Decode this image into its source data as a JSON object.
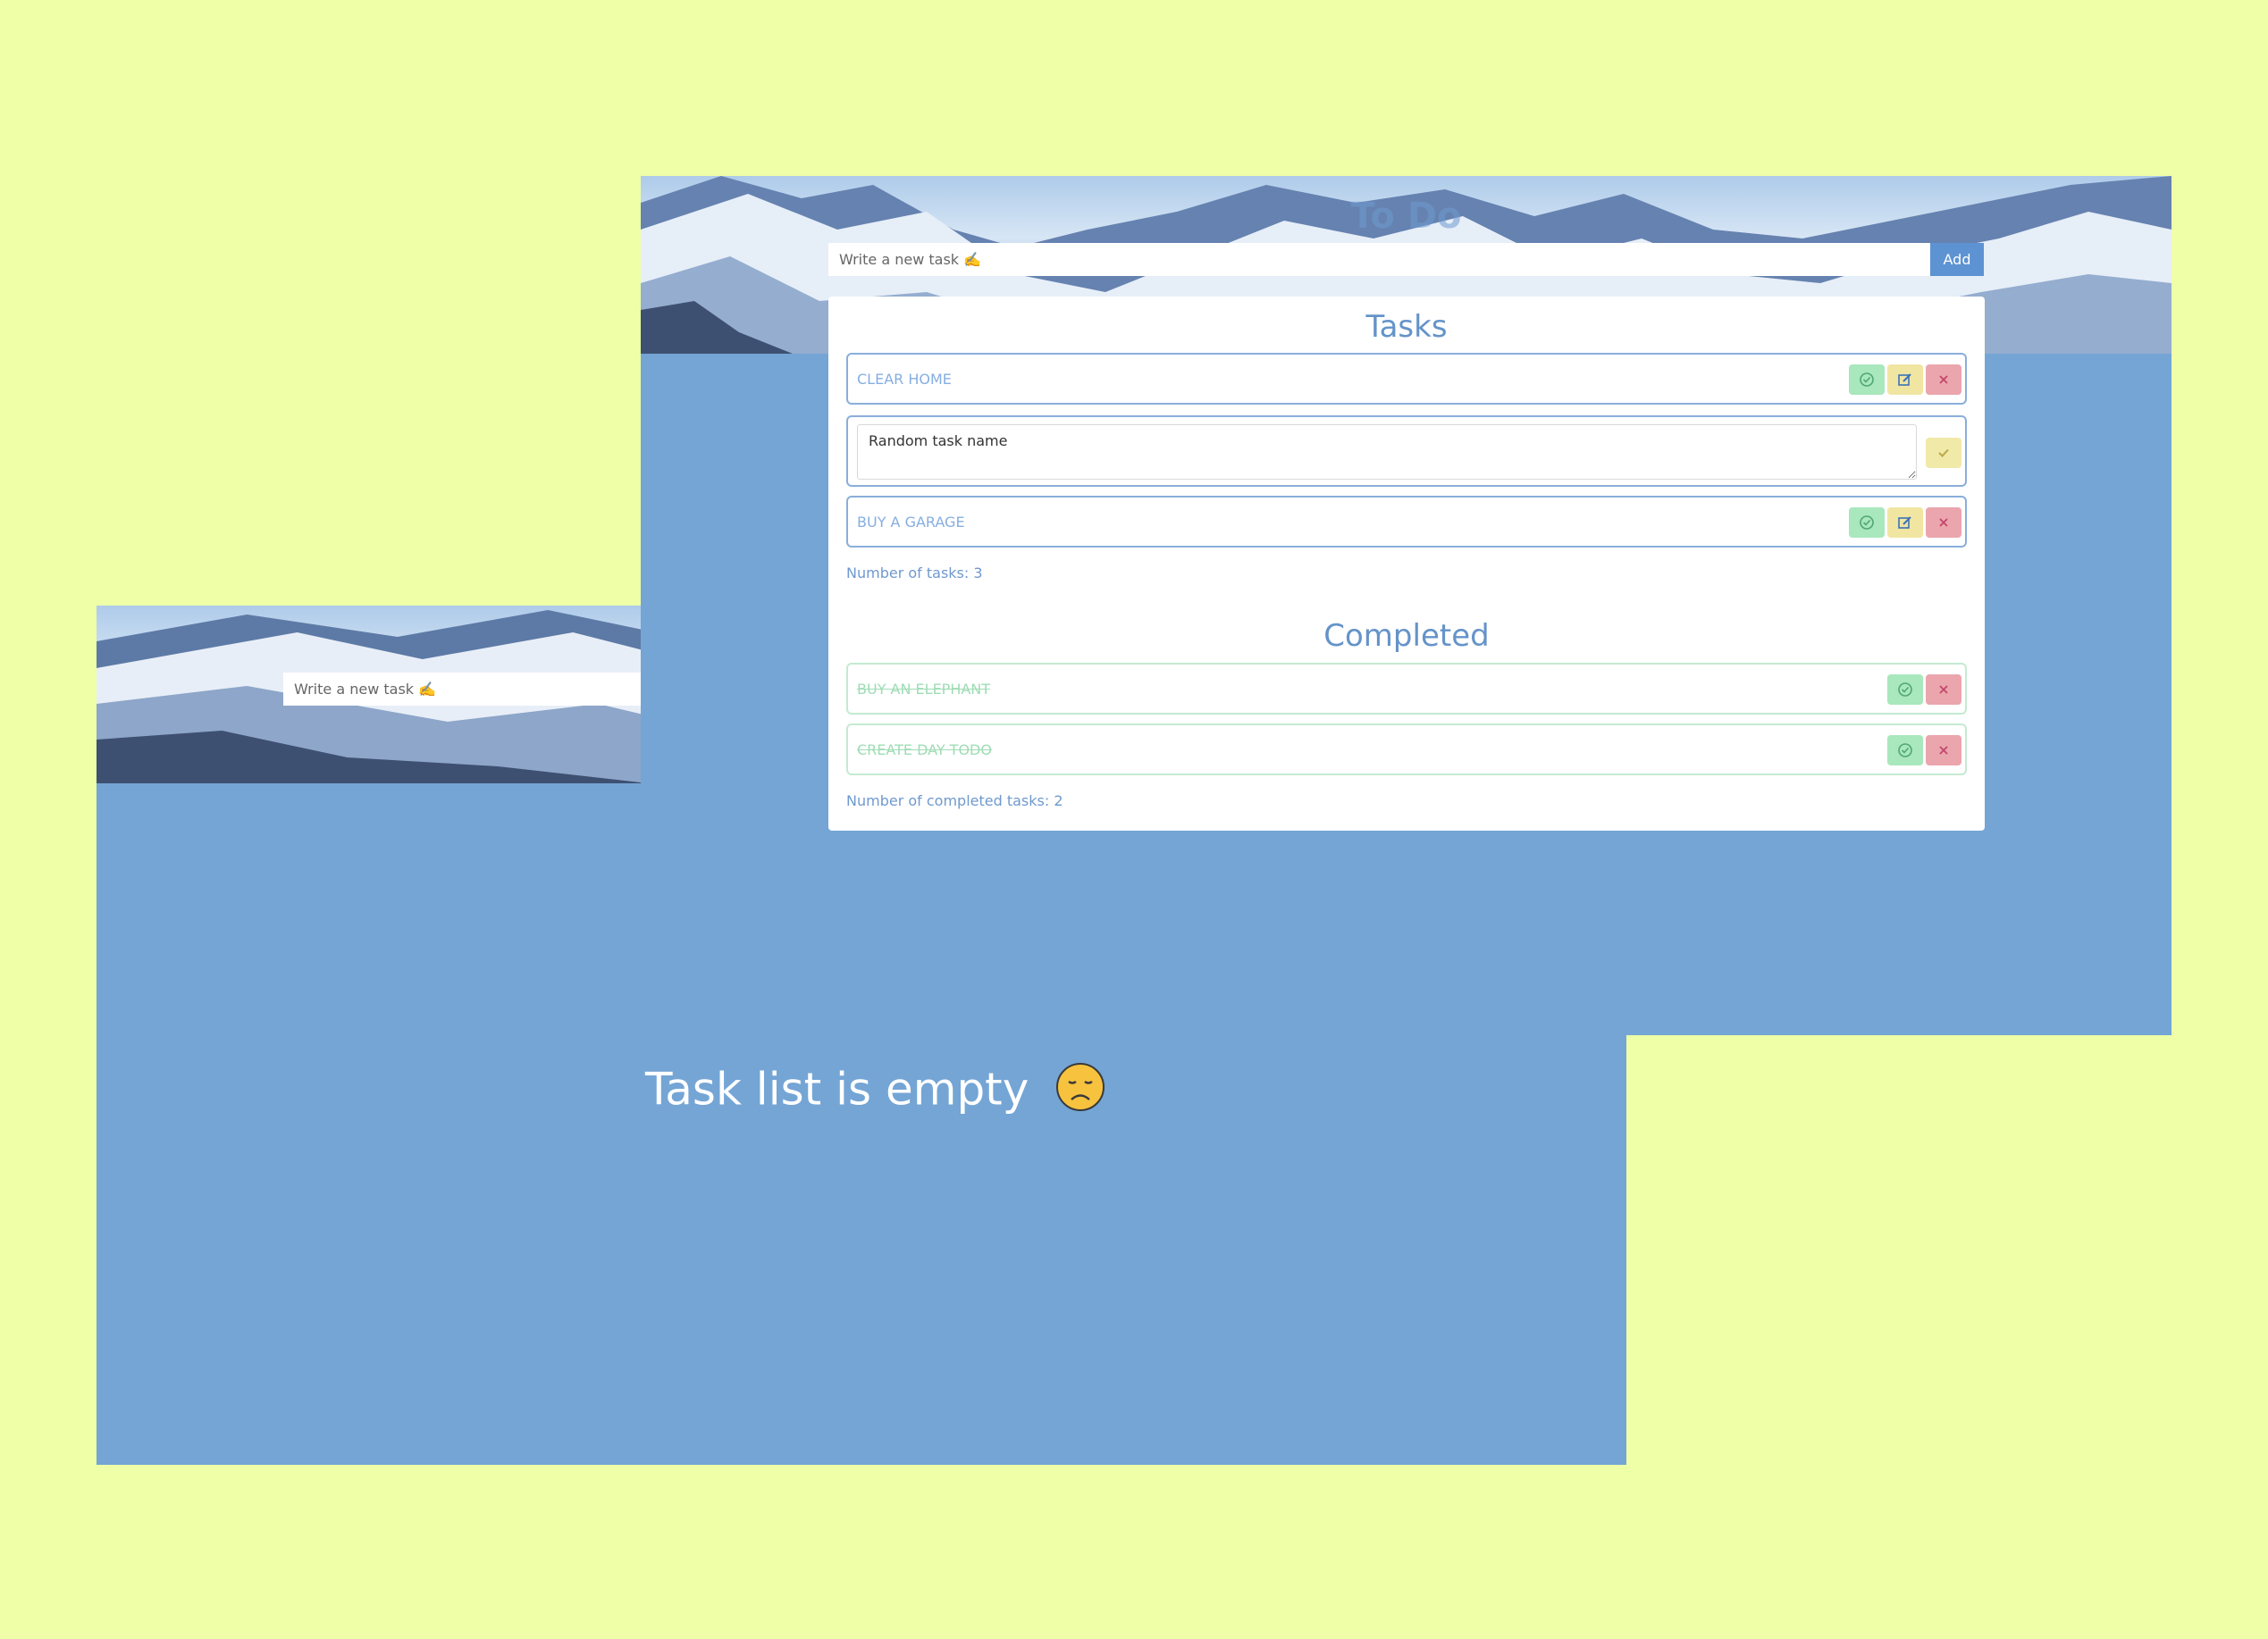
{
  "back_screen": {
    "input_placeholder": "Write a new task ✍️",
    "empty_message": "Task list is empty"
  },
  "front_screen": {
    "title": "To Do",
    "input_placeholder": "Write a new task ✍️",
    "add_label": "Add",
    "tasks_heading": "Tasks",
    "tasks": [
      {
        "label": "Clear home"
      },
      {
        "label": "Random task name",
        "editing": true
      },
      {
        "label": "Buy a garage"
      }
    ],
    "tasks_count": "Number of tasks: 3",
    "completed_heading": "Completed",
    "completed": [
      {
        "label": "Buy an elephant"
      },
      {
        "label": "Create day todo"
      }
    ],
    "completed_count": "Number of completed tasks: 2"
  },
  "colors": {
    "page_background": "#eeffa8",
    "app_background": "#74a5d5",
    "accent": "#5d93d2",
    "complete_button": "#a9e7bd",
    "edit_button": "#f1e5a2",
    "delete_button": "#eba5ad"
  },
  "icons": {
    "complete": "check-circle-icon",
    "edit": "pencil-square-icon",
    "delete": "close-icon",
    "save": "check-icon",
    "empty": "sad-face-emoji"
  }
}
